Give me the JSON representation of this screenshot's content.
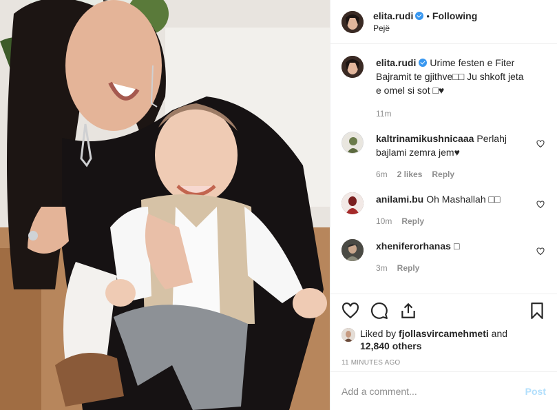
{
  "header": {
    "username": "elita.rudi",
    "dot": "•",
    "following_label": "Following",
    "location": "Pejë"
  },
  "caption": {
    "username": "elita.rudi",
    "text": "Urime festen e Fiter Bajramit te gjithve□□ Ju shkoft jeta e omel si sot □♥",
    "time": "11m"
  },
  "comments": [
    {
      "username": "kaltrinamikushnicaaa",
      "text": "Perlahj bajlami zemra jem♥",
      "time": "6m",
      "likes": "2 likes",
      "reply": "Reply"
    },
    {
      "username": "anilami.bu",
      "text": "Oh Mashallah □□",
      "time": "10m",
      "reply": "Reply"
    },
    {
      "username": "xheniferorhanas",
      "text": "□",
      "time": "3m",
      "reply": "Reply"
    }
  ],
  "likes": {
    "prefix": "Liked by",
    "user": "fjollasvircamehmeti",
    "and": "and",
    "count": "12,840 others"
  },
  "timestamp": "11 MINUTES AGO",
  "add_comment": {
    "placeholder": "Add a comment...",
    "post_label": "Post"
  },
  "colors": {
    "verified": "#3897f0",
    "post_disabled": "#b2dffc",
    "muted": "#8e8e8e"
  },
  "icons": [
    "heart-icon",
    "comment-icon",
    "share-icon",
    "bookmark-icon",
    "verified-badge-icon"
  ]
}
